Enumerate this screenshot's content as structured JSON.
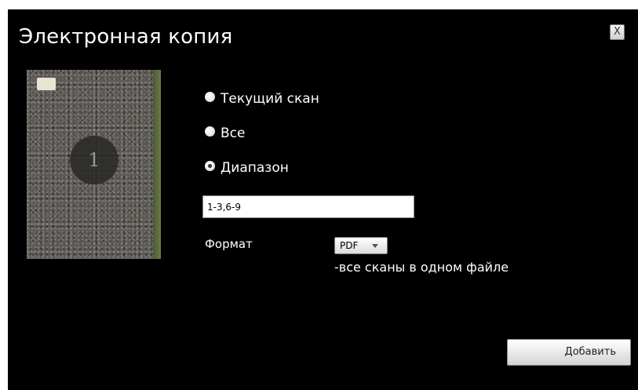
{
  "dialog": {
    "title": "Электронная копия",
    "close_label": "X"
  },
  "thumbnail": {
    "page_number": "1"
  },
  "options": [
    {
      "label": "Текущий скан",
      "checked": false
    },
    {
      "label": "Все",
      "checked": false
    },
    {
      "label": "Диапазон",
      "checked": true
    }
  ],
  "range": {
    "value": "1-3,6-9"
  },
  "format": {
    "label": "Формат",
    "selected": "PDF",
    "description": "-все сканы в одном файле"
  },
  "actions": {
    "add_label": "Добавить"
  }
}
